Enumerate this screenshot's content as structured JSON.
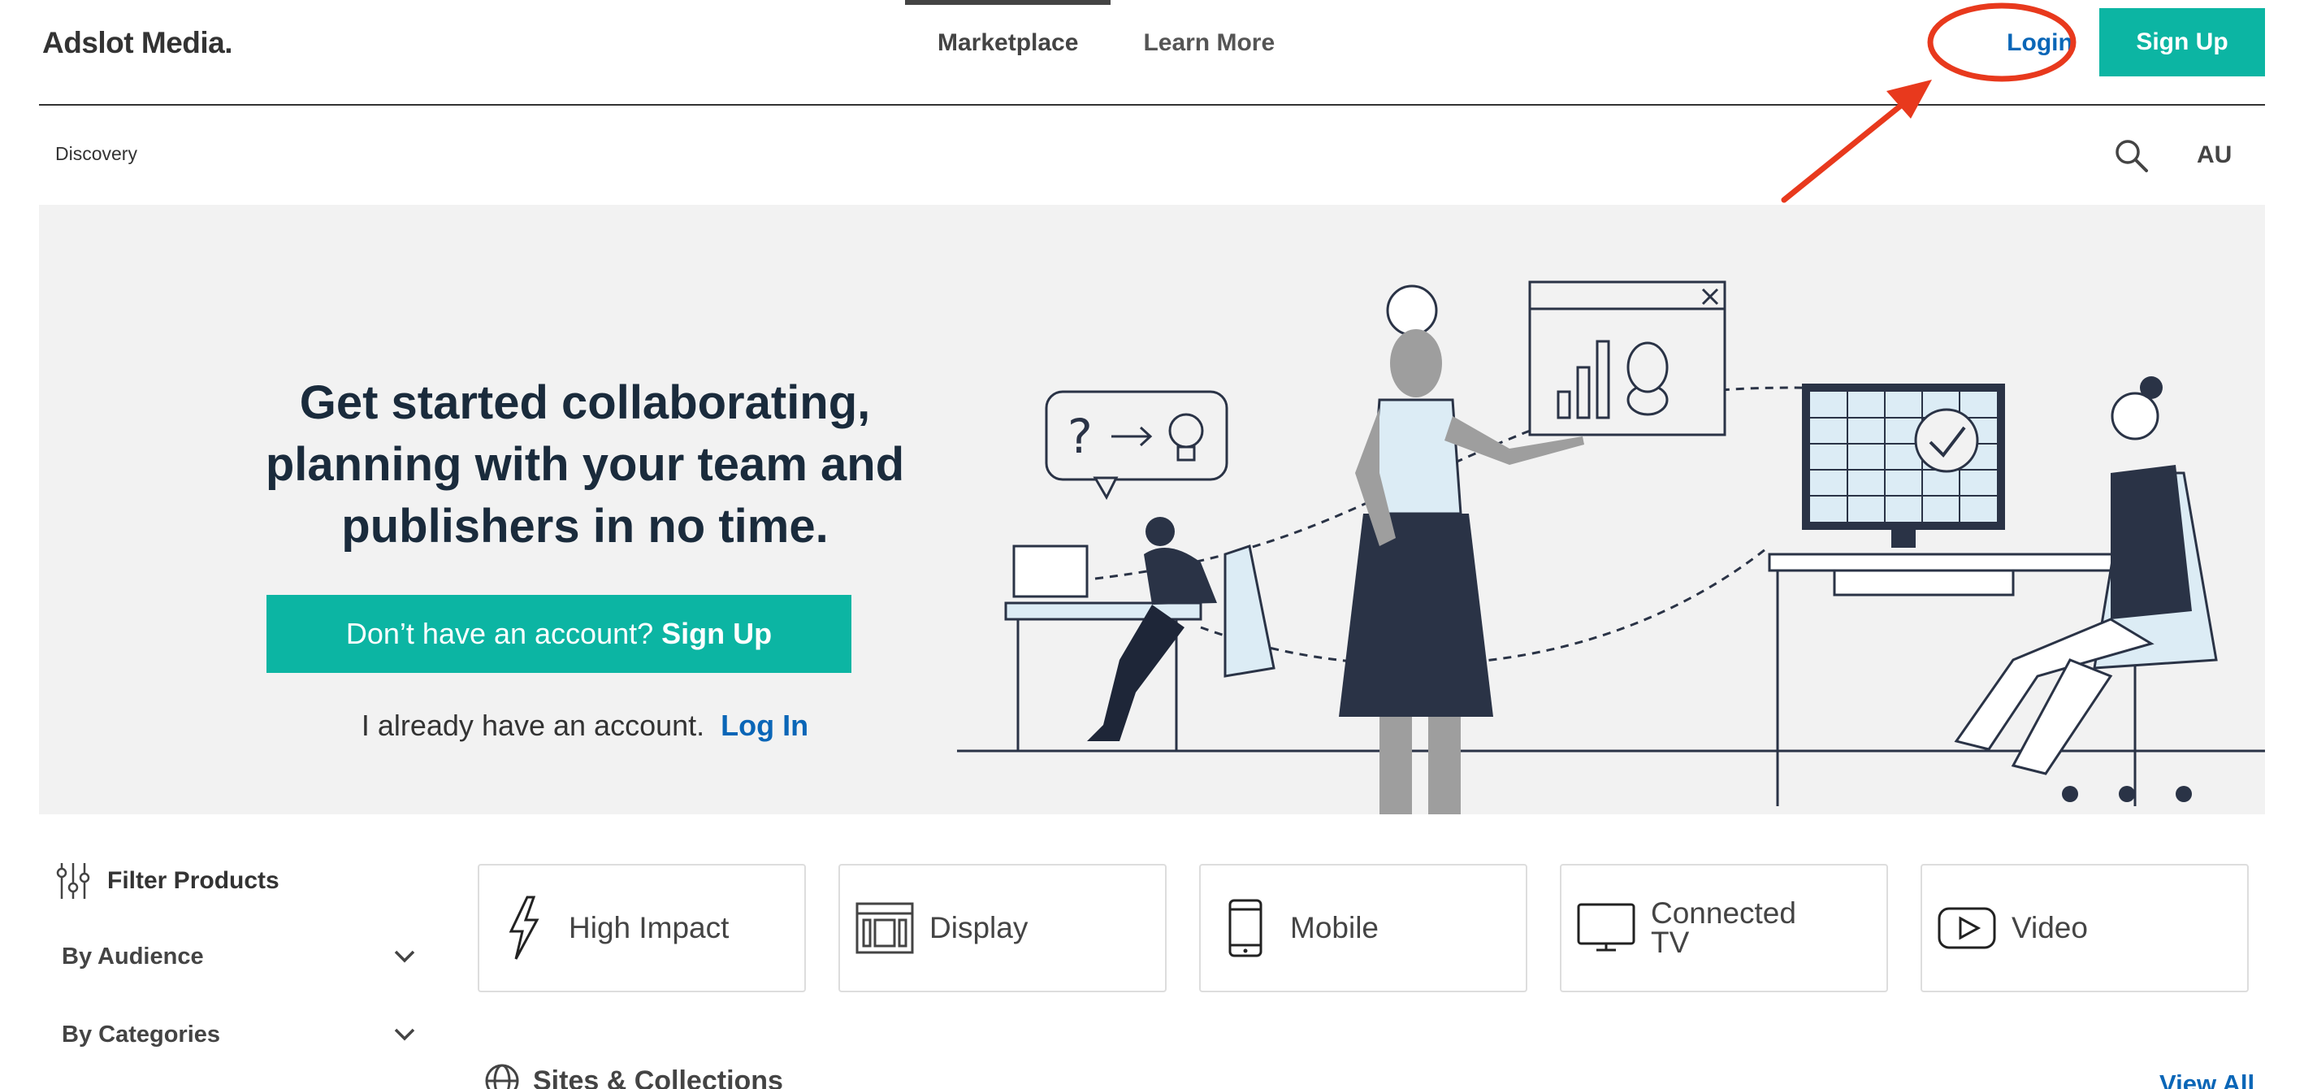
{
  "header": {
    "logo": "Adslot Media.",
    "nav": [
      {
        "label": "Marketplace",
        "active": true
      },
      {
        "label": "Learn More",
        "active": false
      }
    ],
    "login_label": "Login",
    "signup_label": "Sign Up"
  },
  "subheader": {
    "breadcrumb": "Discovery",
    "region": "AU"
  },
  "hero": {
    "title": "Get started collaborating, planning with your team and publishers in no time.",
    "cta_prefix": "Don’t have an account?",
    "cta_action": "Sign Up",
    "login_prefix": "I already have an account.",
    "login_action": "Log In"
  },
  "filters": {
    "title": "Filter Products",
    "groups": [
      "By Audience",
      "By Categories"
    ]
  },
  "categories": [
    {
      "label": "High Impact",
      "icon": "lightning-icon"
    },
    {
      "label": "Display",
      "icon": "display-layout-icon"
    },
    {
      "label": "Mobile",
      "icon": "mobile-phone-icon"
    },
    {
      "label": "Connected TV",
      "icon": "tv-icon"
    },
    {
      "label": "Video",
      "icon": "play-icon"
    }
  ],
  "sites": {
    "title": "Sites & Collections",
    "view_all": "View All"
  },
  "colors": {
    "accent": "#0cb5a3",
    "link": "#0a66b7",
    "annotation": "#e8391d"
  }
}
